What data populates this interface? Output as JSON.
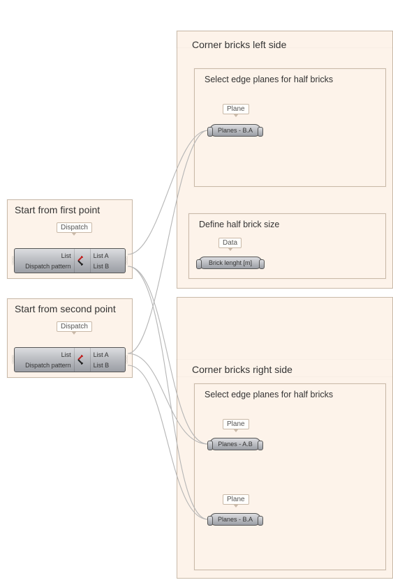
{
  "groups": {
    "g1": {
      "title": "Start from first point",
      "caption": "Dispatch"
    },
    "g2": {
      "title": "Start from second point",
      "caption": "Dispatch"
    },
    "topRegion": {
      "title": "Corner bricks left side"
    },
    "subTop": {
      "title": "Select edge planes for half bricks",
      "caption": "Plane"
    },
    "subMid": {
      "title": "Define half brick size",
      "caption": "Data"
    },
    "bottomRegion": {
      "title": "Corner bricks right side"
    },
    "subBottom": {
      "title": "Select edge planes for half bricks",
      "caption1": "Plane",
      "caption2": "Plane"
    }
  },
  "components": {
    "dispatch": {
      "in1": "List",
      "in2": "Dispatch pattern",
      "out1": "List A",
      "out2": "List B"
    }
  },
  "params": {
    "p1": "Planes - B.A",
    "p2": "Brick lenght [m]",
    "p3": "Planes - A.B",
    "p4": "Planes - B.A"
  },
  "icon": "dispatch-icon"
}
